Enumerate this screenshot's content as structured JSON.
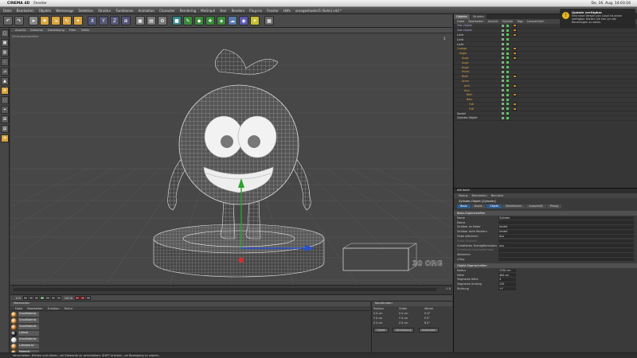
{
  "macmenu": {
    "apple": "",
    "app": "CINEMA 4D",
    "items": [
      "Fenster"
    ],
    "right": [
      "",
      "Do. 16. Aug. 14:03:16",
      ""
    ]
  },
  "c4dmenu": {
    "items": [
      "Datei",
      "Bearbeiten",
      "Objekte",
      "Werkzeuge",
      "Selektion",
      "Struktur",
      "Funktionen",
      "Animation",
      "Character",
      "Rendering",
      "MoGraph",
      "Hair",
      "Rendern",
      "Plug-ins",
      "Fenster",
      "Hilfe"
    ],
    "document": "orangeshooter5 (Sohn).c4d *"
  },
  "viewport": {
    "menu": [
      "Ansicht",
      "Kameras",
      "Darstellung",
      "Filter",
      "Tafeln"
    ],
    "label": "Zentralperspektive",
    "corner": "↕"
  },
  "timeline": {
    "frame": "0 B"
  },
  "playback": {
    "frame_start": "0 B",
    "frame_end": "100 B"
  },
  "materials": {
    "title": "Materialien",
    "menu": [
      "Datei",
      "Bearbeiten",
      "Funktion",
      "Textur"
    ],
    "items": [
      {
        "name": "GrauMaterial",
        "color": "#c8801c"
      },
      {
        "name": "GrauMaterial",
        "color": "#d89030"
      },
      {
        "name": "GrauMaterial",
        "color": "#c07020"
      },
      {
        "name": "Lidmat",
        "color": "#222222"
      },
      {
        "name": "GrauMaterial",
        "color": "#e0e0e0"
      },
      {
        "name": "Lidmaterial",
        "color": "#c88030"
      },
      {
        "name": "Material",
        "color": "#a06010"
      }
    ]
  },
  "coordinates": {
    "title": "Koordinaten",
    "headers": [
      "Position",
      "Größe",
      "Winkel"
    ],
    "rows": [
      [
        "X  0 cm",
        "X  0 cm",
        "H  0°"
      ],
      [
        "Y  0 cm",
        "Y  0 cm",
        "P  0°"
      ],
      [
        "Z  0 cm",
        "Z  0 cm",
        "B  0°"
      ]
    ],
    "mode": "Objekt",
    "mode2": "Abmessung",
    "apply": "Anwenden"
  },
  "status": {
    "text": "Verschieben: Klicken und ziehen, um Elemente zu verschieben. SHIFT drücken, um Bewegung zu rastern."
  },
  "objects": {
    "tabs": [
      "Objekte",
      "Struktur"
    ],
    "menu": [
      "Datei",
      "Bearbeiten",
      "Ansicht",
      "Objekte",
      "Tags",
      "Lesezeichen"
    ],
    "rows": [
      {
        "name": "Text-Objekt",
        "indent": 0,
        "color": "#aad"
      },
      {
        "name": "Text-Objekt",
        "indent": 0,
        "color": "#aad"
      },
      {
        "name": "Licht",
        "indent": 0,
        "color": "#ddd"
      },
      {
        "name": "Licht",
        "indent": 0,
        "color": "#ddd"
      },
      {
        "name": "Licht",
        "indent": 0,
        "color": "#ddd"
      },
      {
        "name": "Orange",
        "indent": 0,
        "color": "#e6a33c"
      },
      {
        "name": "Kugel",
        "indent": 1,
        "color": "#e6a33c"
      },
      {
        "name": "Auge",
        "indent": 2,
        "color": "#e6a33c"
      },
      {
        "name": "Auge",
        "indent": 2,
        "color": "#e6a33c"
      },
      {
        "name": "Auge",
        "indent": 2,
        "color": "#e6a33c"
      },
      {
        "name": "Mund",
        "indent": 2,
        "color": "#e6a33c"
      },
      {
        "name": "Blatt",
        "indent": 2,
        "color": "#e6a33c"
      },
      {
        "name": "Arme",
        "indent": 2,
        "color": "#e6a33c"
      },
      {
        "name": "Arm",
        "indent": 3,
        "color": "#e6a33c"
      },
      {
        "name": "Arm",
        "indent": 3,
        "color": "#e6a33c"
      },
      {
        "name": "Bein",
        "indent": 4,
        "color": "#e6a33c"
      },
      {
        "name": "Bein",
        "indent": 4,
        "color": "#e6a33c"
      },
      {
        "name": "Fuß",
        "indent": 5,
        "color": "#e6a33c"
      },
      {
        "name": "Fuß",
        "indent": 5,
        "color": "#e6a33c"
      },
      {
        "name": "Sockel",
        "indent": 0,
        "color": "#ddd"
      },
      {
        "name": "Zylinder-Objekt",
        "indent": 0,
        "color": "#ddd"
      }
    ]
  },
  "notification": {
    "title": "Update verfügbar",
    "body": "Eine neue Version von Conal ist online verfügbar. Klicken Sie hier um die Neuerungen zu sehen."
  },
  "attributes": {
    "title": "Attribute",
    "menu": [
      "Modus",
      "Bearbeiten",
      "Benutzer"
    ],
    "object": "Zylinder-Objekt [Zylinder]",
    "subtabs": [
      "Basis",
      "Koord.",
      "Objekt",
      "Deckflächen",
      "Ausschnitt",
      "Phong"
    ],
    "basic_section": "Basis-Eigenschaften",
    "basic": [
      {
        "label": "Name",
        "value": "Zylinder"
      },
      {
        "label": "Ebene",
        "value": ""
      },
      {
        "label": "Sichtbar im Editor",
        "value": "Undef."
      },
      {
        "label": "Sichtbar beim Rendern",
        "value": "Undef."
      },
      {
        "label": "Farbe aktivieren",
        "value": "Aus"
      },
      {
        "label": "Farbe (Ansicht)",
        "value": "",
        "dim": true
      },
      {
        "label": "Schattierter Drahtgittermodus",
        "value": "Aus"
      },
      {
        "label": "Schattierte Drahtgitterfarbe",
        "value": "",
        "dim": true
      },
      {
        "label": "Aktivieren",
        "value": ""
      },
      {
        "label": "X-Ray",
        "value": ""
      }
    ],
    "object_section": "Objekt-Eigenschaften",
    "object_props": [
      {
        "label": "Radius",
        "value": "2250 cm"
      },
      {
        "label": "Höhe",
        "value": "400 cm"
      },
      {
        "label": "Segmente Höhe",
        "value": "4"
      },
      {
        "label": "Segmente Umfang",
        "value": "120"
      },
      {
        "label": "Richtung",
        "value": "+Y"
      }
    ]
  }
}
